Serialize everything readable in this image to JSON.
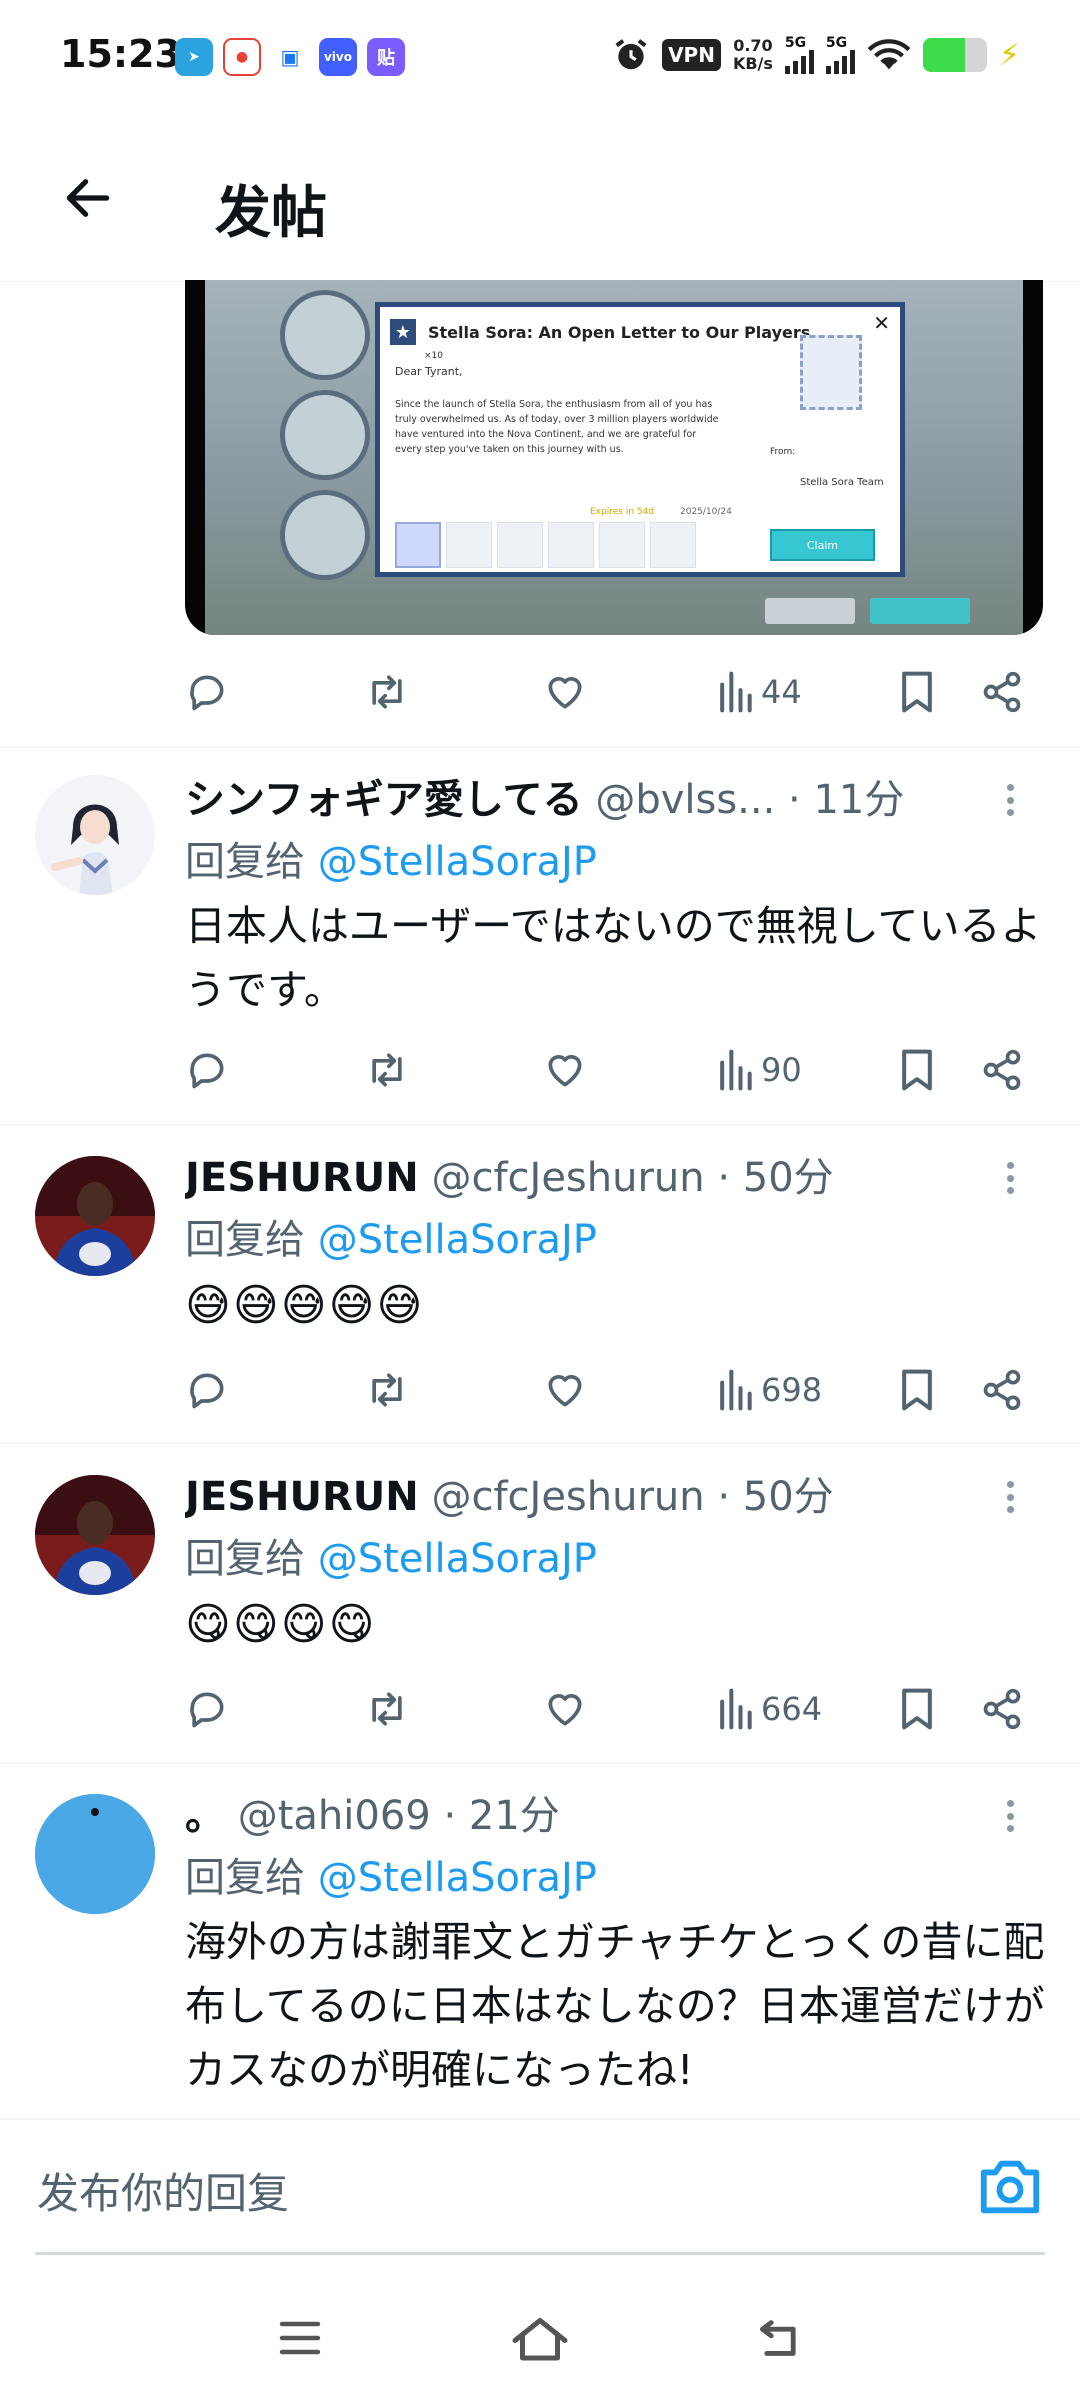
{
  "status_bar": {
    "time": "15:23",
    "apps": [
      {
        "icon": "telegram-icon",
        "color": "#2aa3df",
        "glyph": "➤"
      },
      {
        "icon": "maps-pin-icon",
        "color": "#e94235",
        "glyph": "●"
      },
      {
        "icon": "chat-bubbles-icon",
        "color": "#1877f2",
        "glyph": "▣"
      },
      {
        "icon": "vivo-icon",
        "color": "#415fff",
        "label": "vivo"
      },
      {
        "icon": "tieba-icon",
        "color": "#7b5cff",
        "label": "贴"
      }
    ],
    "vpn": "VPN",
    "net_speed_value": "0.70",
    "net_speed_unit": "KB/s",
    "signal_1_label": "5G",
    "signal_2_label": "5G",
    "battery_level": 0.65
  },
  "header": {
    "title": "发帖"
  },
  "media": {
    "letter_title": "Stella Sora: An Open Letter to Our Players",
    "greeting": "Dear Tyrant,",
    "body": "Since the launch of Stella Sora, the enthusiasm from all of you has truly overwhelmed us. As of today, over 3 million players worldwide have ventured into the Nova Continent, and we are grateful for every step you've taken on this journey with us.",
    "from_label": "From:",
    "sender": "Stella Sora Team",
    "expires": "Expires in 54d",
    "date": "2025/10/24",
    "reward_qty": "×10",
    "claim": "Claim"
  },
  "colors": {
    "accent": "#1d9bf0",
    "text": "#0f1419",
    "muted": "#536471",
    "divider": "#eff3f4"
  },
  "top_actions": {
    "views": "44"
  },
  "posts": [
    {
      "name": "シンフォギア愛してる",
      "handle": "@bvlss...",
      "time": "· 11分",
      "reply_prefix": "回复给",
      "reply_to": "@StellaSoraJP",
      "text": "日本人はユーザーではないので無視しているようです。",
      "views": "90"
    },
    {
      "name": "JESHURUN",
      "handle": "@cfcJeshurun",
      "time": "· 50分",
      "reply_prefix": "回复给",
      "reply_to": "@StellaSoraJP",
      "text": "😅😅😅😅😅",
      "views": "698"
    },
    {
      "name": "JESHURUN",
      "handle": "@cfcJeshurun",
      "time": "· 50分",
      "reply_prefix": "回复给",
      "reply_to": "@StellaSoraJP",
      "text": "😋😋😋😋",
      "views": "664"
    },
    {
      "name": "。",
      "handle": "@tahi069",
      "time": "· 21分",
      "reply_prefix": "回复给",
      "reply_to": "@StellaSoraJP",
      "text": "海外の方は謝罪文とガチャチケとっくの昔に配布してるのに日本はなしなの？日本運営だけがカスなのが明確になったね!"
    }
  ],
  "composer": {
    "placeholder": "发布你的回复",
    "camera_icon": "camera-icon"
  },
  "nav": {
    "menu_icon": "menu-icon",
    "home_icon": "home-icon",
    "back_icon": "back-nav-icon"
  }
}
